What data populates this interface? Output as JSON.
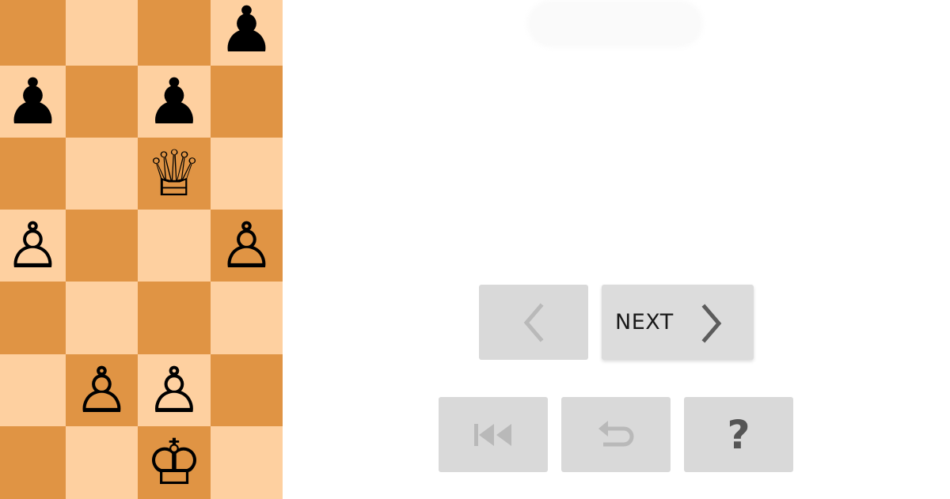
{
  "board": {
    "colors": {
      "dark": "#e09444",
      "light": "#fed0a0"
    },
    "squares": [
      {
        "shade": "dark",
        "piece": "",
        "color": ""
      },
      {
        "shade": "light",
        "piece": "",
        "color": ""
      },
      {
        "shade": "dark",
        "piece": "",
        "color": ""
      },
      {
        "shade": "light",
        "piece": "pawn",
        "color": "black"
      },
      {
        "shade": "light",
        "piece": "pawn",
        "color": "black"
      },
      {
        "shade": "dark",
        "piece": "",
        "color": ""
      },
      {
        "shade": "light",
        "piece": "pawn",
        "color": "black"
      },
      {
        "shade": "dark",
        "piece": "",
        "color": ""
      },
      {
        "shade": "dark",
        "piece": "",
        "color": ""
      },
      {
        "shade": "light",
        "piece": "",
        "color": ""
      },
      {
        "shade": "dark",
        "piece": "queen",
        "color": "white"
      },
      {
        "shade": "light",
        "piece": "",
        "color": ""
      },
      {
        "shade": "light",
        "piece": "pawn",
        "color": "white"
      },
      {
        "shade": "dark",
        "piece": "",
        "color": ""
      },
      {
        "shade": "light",
        "piece": "",
        "color": ""
      },
      {
        "shade": "dark",
        "piece": "pawn",
        "color": "white"
      },
      {
        "shade": "dark",
        "piece": "",
        "color": ""
      },
      {
        "shade": "light",
        "piece": "",
        "color": ""
      },
      {
        "shade": "dark",
        "piece": "",
        "color": ""
      },
      {
        "shade": "light",
        "piece": "",
        "color": ""
      },
      {
        "shade": "light",
        "piece": "",
        "color": ""
      },
      {
        "shade": "dark",
        "piece": "pawn",
        "color": "white"
      },
      {
        "shade": "light",
        "piece": "pawn",
        "color": "white"
      },
      {
        "shade": "dark",
        "piece": "",
        "color": ""
      },
      {
        "shade": "dark",
        "piece": "",
        "color": ""
      },
      {
        "shade": "light",
        "piece": "",
        "color": ""
      },
      {
        "shade": "dark",
        "piece": "king",
        "color": "white"
      },
      {
        "shade": "light",
        "piece": "",
        "color": ""
      }
    ]
  },
  "controls": {
    "prev": {
      "icon": "chevron-left-icon"
    },
    "next": {
      "label": "NEXT",
      "icon": "chevron-right-icon"
    },
    "first": {
      "icon": "skip-to-start-icon"
    },
    "undo": {
      "icon": "undo-arrow-icon"
    },
    "help": {
      "label": "?"
    }
  }
}
